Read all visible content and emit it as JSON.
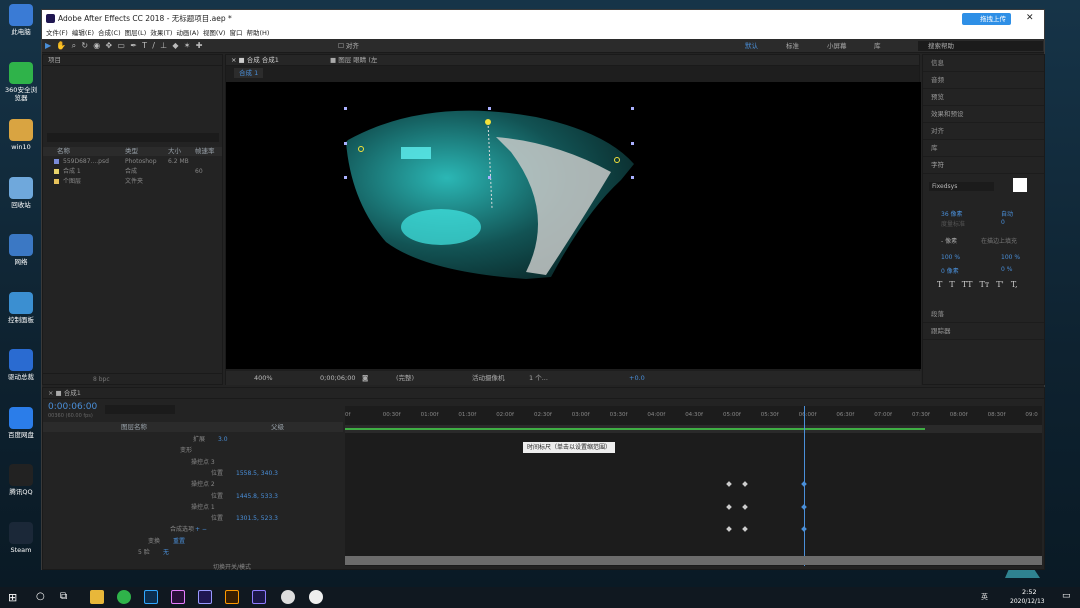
{
  "desktop": {
    "icons": [
      {
        "label": "此电脑",
        "color": "#3a7bd5"
      },
      {
        "label": "360安全浏览器",
        "color": "#2fb34a"
      },
      {
        "label": "win10",
        "color": "#d9a441"
      },
      {
        "label": "回收站",
        "color": "#6fa8dc"
      },
      {
        "label": "网络",
        "color": "#3b78c4"
      },
      {
        "label": "控制面板",
        "color": "#3b8fd1"
      },
      {
        "label": "驱动总裁",
        "color": "#2a6bd1"
      },
      {
        "label": "百度网盘",
        "color": "#2b7de9"
      },
      {
        "label": "腾讯QQ",
        "color": "#222222"
      },
      {
        "label": "Steam",
        "color": "#1b2838"
      }
    ]
  },
  "window": {
    "title": "Adobe After Effects CC 2018 - 无标题项目.aep *",
    "upload_label": "拖拽上传",
    "close": "✕"
  },
  "menu": [
    "文件(F)",
    "编辑(E)",
    "合成(C)",
    "图层(L)",
    "效果(T)",
    "动画(A)",
    "视图(V)",
    "窗口",
    "帮助(H)"
  ],
  "toolbar": {
    "align_label": "对齐",
    "workspaces": [
      "默认",
      "标准",
      "小屏幕",
      "库"
    ],
    "search_placeholder": "搜索帮助"
  },
  "project": {
    "title": "项目",
    "columns": [
      "名称",
      "类型",
      "大小",
      "帧速率"
    ],
    "rows": [
      {
        "name": "559D687....psd",
        "type": "Photoshop",
        "size": "6.2 MB",
        "fps": "",
        "color": "#7a8bd8"
      },
      {
        "name": "合成 1",
        "type": "合成",
        "size": "",
        "fps": "60",
        "color": "#e8d36a"
      },
      {
        "name": "个图层",
        "type": "文件夹",
        "size": "",
        "fps": "",
        "color": "#e8c25a"
      }
    ],
    "bpc": "8 bpc"
  },
  "comp": {
    "tab_label": "合成 合成1",
    "layer_tab": "图层 眼睛 (左",
    "subtab": "合成 1",
    "zoom": "400%",
    "timecode": "0;00;06;00",
    "quality": "(完整)",
    "camera": "活动摄像机",
    "views": "1 个...",
    "exposure": "+0.0"
  },
  "right_panel": {
    "items": [
      "信息",
      "音频",
      "预览",
      "效果和预设",
      "对齐",
      "库"
    ],
    "char_title": "字符",
    "font": "Fixedsys",
    "font_size": "36 像素",
    "leading": "自动",
    "kerning": "度量标准",
    "tracking": "0",
    "stroke_width": "- 像素",
    "stroke_type": "在描边上填充",
    "vscale": "100 %",
    "hscale": "100 %",
    "baseline": "0 像素",
    "tsume": "0 %",
    "style_buttons": [
      "T",
      "T",
      "TT",
      "Tт",
      "T'",
      "T,"
    ],
    "paragraph": "段落",
    "tracker": "跟踪器"
  },
  "timeline": {
    "tab": "合成1",
    "timecode": "0:00:06:00",
    "timecode_sub": "00360 (60.00 fps)",
    "col_name": "图层名称",
    "col_parent": "父级",
    "ruler": [
      "0f",
      "00:30f",
      "01:00f",
      "01:30f",
      "02:00f",
      "02:30f",
      "03:00f",
      "03:30f",
      "04:00f",
      "04:30f",
      "05:00f",
      "05:30f",
      "06:00f",
      "06:30f",
      "07:00f",
      "07:30f",
      "08:00f",
      "08:30f",
      "09:0"
    ],
    "tooltip": "时间标尺（单击以设置缩范围）",
    "rows": [
      {
        "label": "扩展",
        "value": "3.0",
        "indent": 150
      },
      {
        "label": "变形",
        "value": "",
        "indent": 137
      },
      {
        "label": "操控点 3",
        "value": "",
        "indent": 148
      },
      {
        "label": "位置",
        "value": "1558.5, 340.3",
        "indent": 168
      },
      {
        "label": "操控点 2",
        "value": "",
        "indent": 148
      },
      {
        "label": "位置",
        "value": "1445.8, 533.3",
        "indent": 168
      },
      {
        "label": "操控点 1",
        "value": "",
        "indent": 148
      },
      {
        "label": "位置",
        "value": "1301.5, 523.3",
        "indent": 168
      },
      {
        "label": "合成选项",
        "value": "+ −",
        "indent": 127
      },
      {
        "label": "变换",
        "value": "重置",
        "indent": 105
      },
      {
        "label": "5  脸",
        "value": "无",
        "indent": 95
      }
    ],
    "footer": "切换开关/模式"
  },
  "taskbar": {
    "time": "2:52",
    "date": "2020/12/13",
    "lang": "英"
  }
}
